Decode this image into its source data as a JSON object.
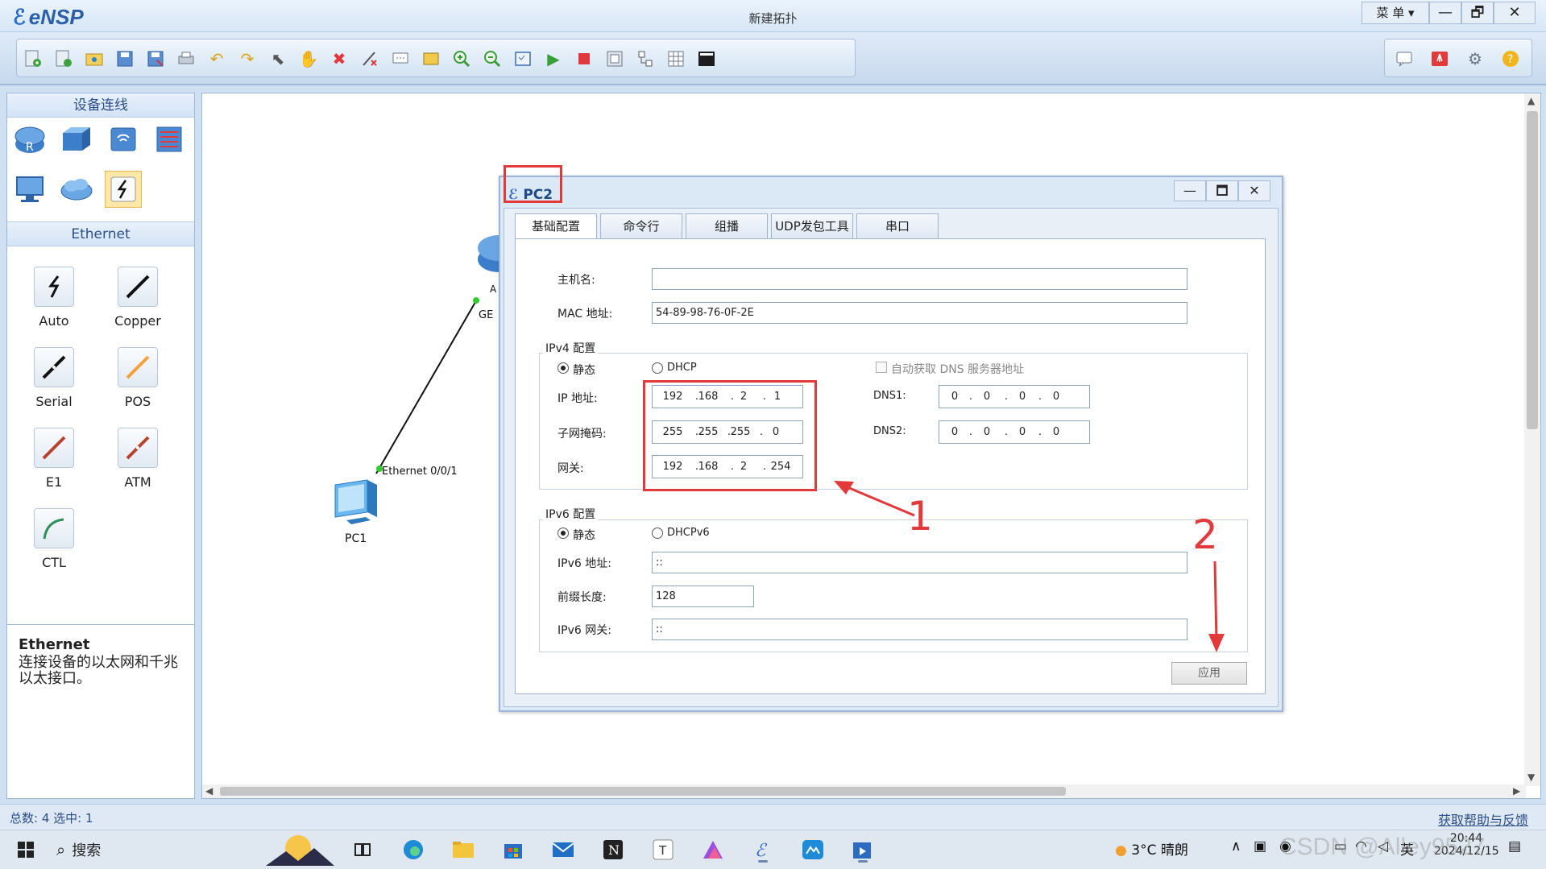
{
  "app": {
    "name": "eNSP",
    "window_title": "新建拓扑",
    "menu_label": "菜 单",
    "minimize": "—",
    "restore": "🗗",
    "close": "✕"
  },
  "left_panel": {
    "header": "设备连线",
    "section": "Ethernet",
    "cables": [
      {
        "label": "Auto"
      },
      {
        "label": "Copper"
      },
      {
        "label": "Serial"
      },
      {
        "label": "POS"
      },
      {
        "label": "E1"
      },
      {
        "label": "ATM"
      },
      {
        "label": "CTL"
      }
    ],
    "desc_title": "Ethernet",
    "desc_text": "连接设备的以太网和千兆以太接口。"
  },
  "topology": {
    "pc1_label": "PC1",
    "pc1_port": "Ethernet 0/0/1",
    "router_label_a": "A",
    "router_label_ge": "GE"
  },
  "dialog": {
    "title": "PC2",
    "tabs": [
      "基础配置",
      "命令行",
      "组播",
      "UDP发包工具",
      "串口"
    ],
    "hostname_label": "主机名:",
    "hostname_value": "",
    "mac_label": "MAC 地址:",
    "mac_value": "54-89-98-76-0F-2E",
    "ipv4_group": "IPv4 配置",
    "static_label": "静态",
    "dhcp_label": "DHCP",
    "auto_dns_label": "自动获取 DNS 服务器地址",
    "ip_label": "IP 地址:",
    "ip": [
      "192",
      "168",
      "2",
      "1"
    ],
    "mask_label": "子网掩码:",
    "mask": [
      "255",
      "255",
      "255",
      "0"
    ],
    "gw_label": "网关:",
    "gw": [
      "192",
      "168",
      "2",
      "254"
    ],
    "dns1_label": "DNS1:",
    "dns1": [
      "0",
      "0",
      "0",
      "0"
    ],
    "dns2_label": "DNS2:",
    "dns2": [
      "0",
      "0",
      "0",
      "0"
    ],
    "ipv6_group": "IPv6 配置",
    "static6_label": "静态",
    "dhcpv6_label": "DHCPv6",
    "ipv6_addr_label": "IPv6 地址:",
    "ipv6_addr_value": "::",
    "prefix_label": "前缀长度:",
    "prefix_value": "128",
    "ipv6_gw_label": "IPv6 网关:",
    "ipv6_gw_value": "::",
    "apply_label": "应用"
  },
  "annotations": {
    "num1": "1",
    "num2": "2",
    "color": "#e23a3a"
  },
  "statusbar": {
    "counts": "总数: 4 选中: 1",
    "help_link": "获取帮助与反馈"
  },
  "taskbar": {
    "search_label": "搜索",
    "weather": "3°C 晴朗",
    "ime": "英",
    "time": "20:44",
    "date": "2024/12/15",
    "watermark": "CSDN @Alley9527"
  }
}
